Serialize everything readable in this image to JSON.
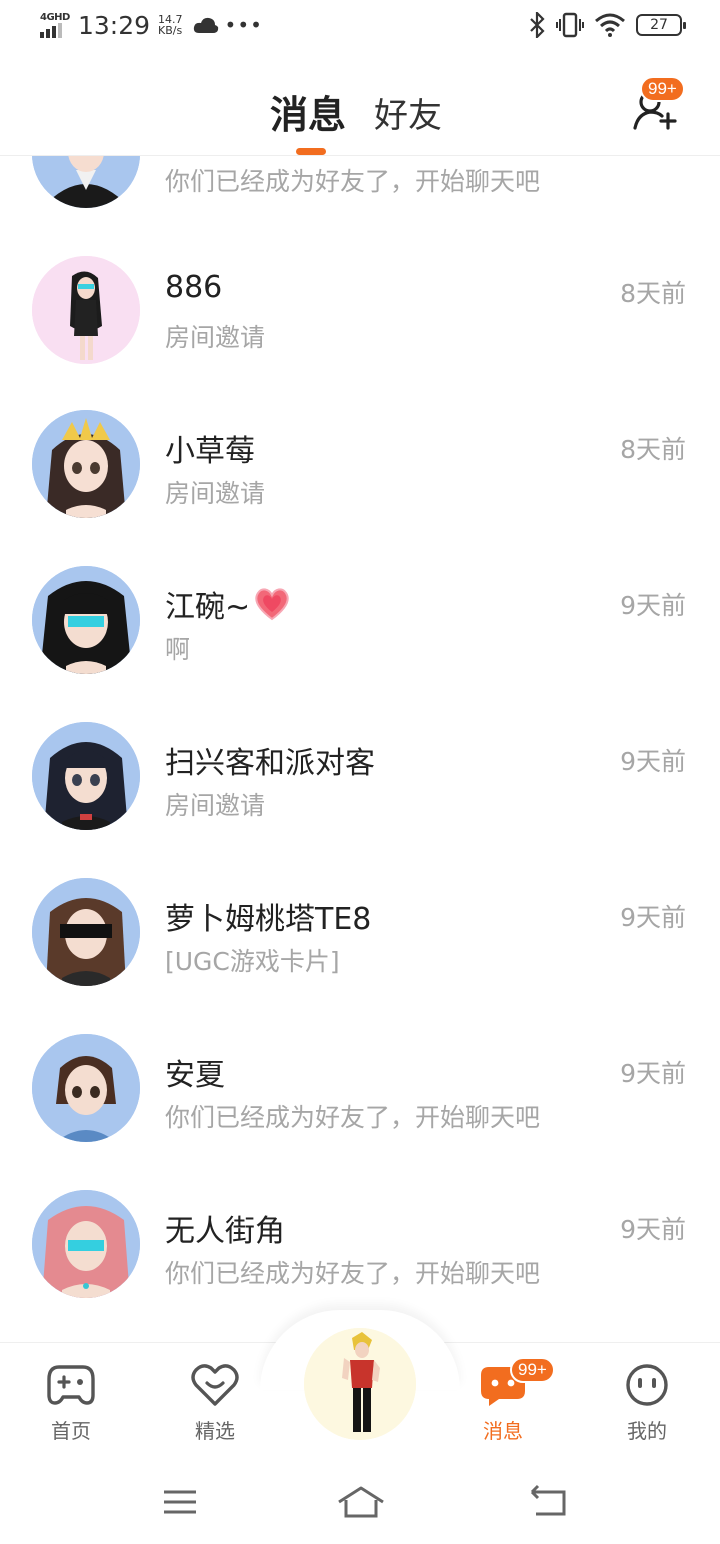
{
  "status_bar": {
    "network": "4GHD",
    "time": "13:29",
    "speed_value": "14.7",
    "speed_unit": "KB/s",
    "battery": "27"
  },
  "header": {
    "tab_messages": "消息",
    "tab_friends": "好友",
    "add_friend_badge": "99+",
    "accent_color": "#f26d1f"
  },
  "messages": [
    {
      "name": "",
      "preview": "你们已经成为好友了，开始聊天吧",
      "time": ""
    },
    {
      "name": "886",
      "preview": "房间邀请",
      "time": "8天前"
    },
    {
      "name": "小草莓",
      "preview": "房间邀请",
      "time": "8天前"
    },
    {
      "name": "江碗~",
      "preview": "啊",
      "time": "9天前"
    },
    {
      "name": "扫兴客和派对客",
      "preview": "房间邀请",
      "time": "9天前"
    },
    {
      "name": "萝卜姆桃塔TE8",
      "preview": "[UGC游戏卡片]",
      "time": "9天前"
    },
    {
      "name": "安夏",
      "preview": "你们已经成为好友了，开始聊天吧",
      "time": "9天前"
    },
    {
      "name": "无人街角",
      "preview": "你们已经成为好友了，开始聊天吧",
      "time": "9天前"
    }
  ],
  "bottom_nav": {
    "home": "首页",
    "featured": "精选",
    "messages": "消息",
    "messages_badge": "99+",
    "mine": "我的"
  }
}
